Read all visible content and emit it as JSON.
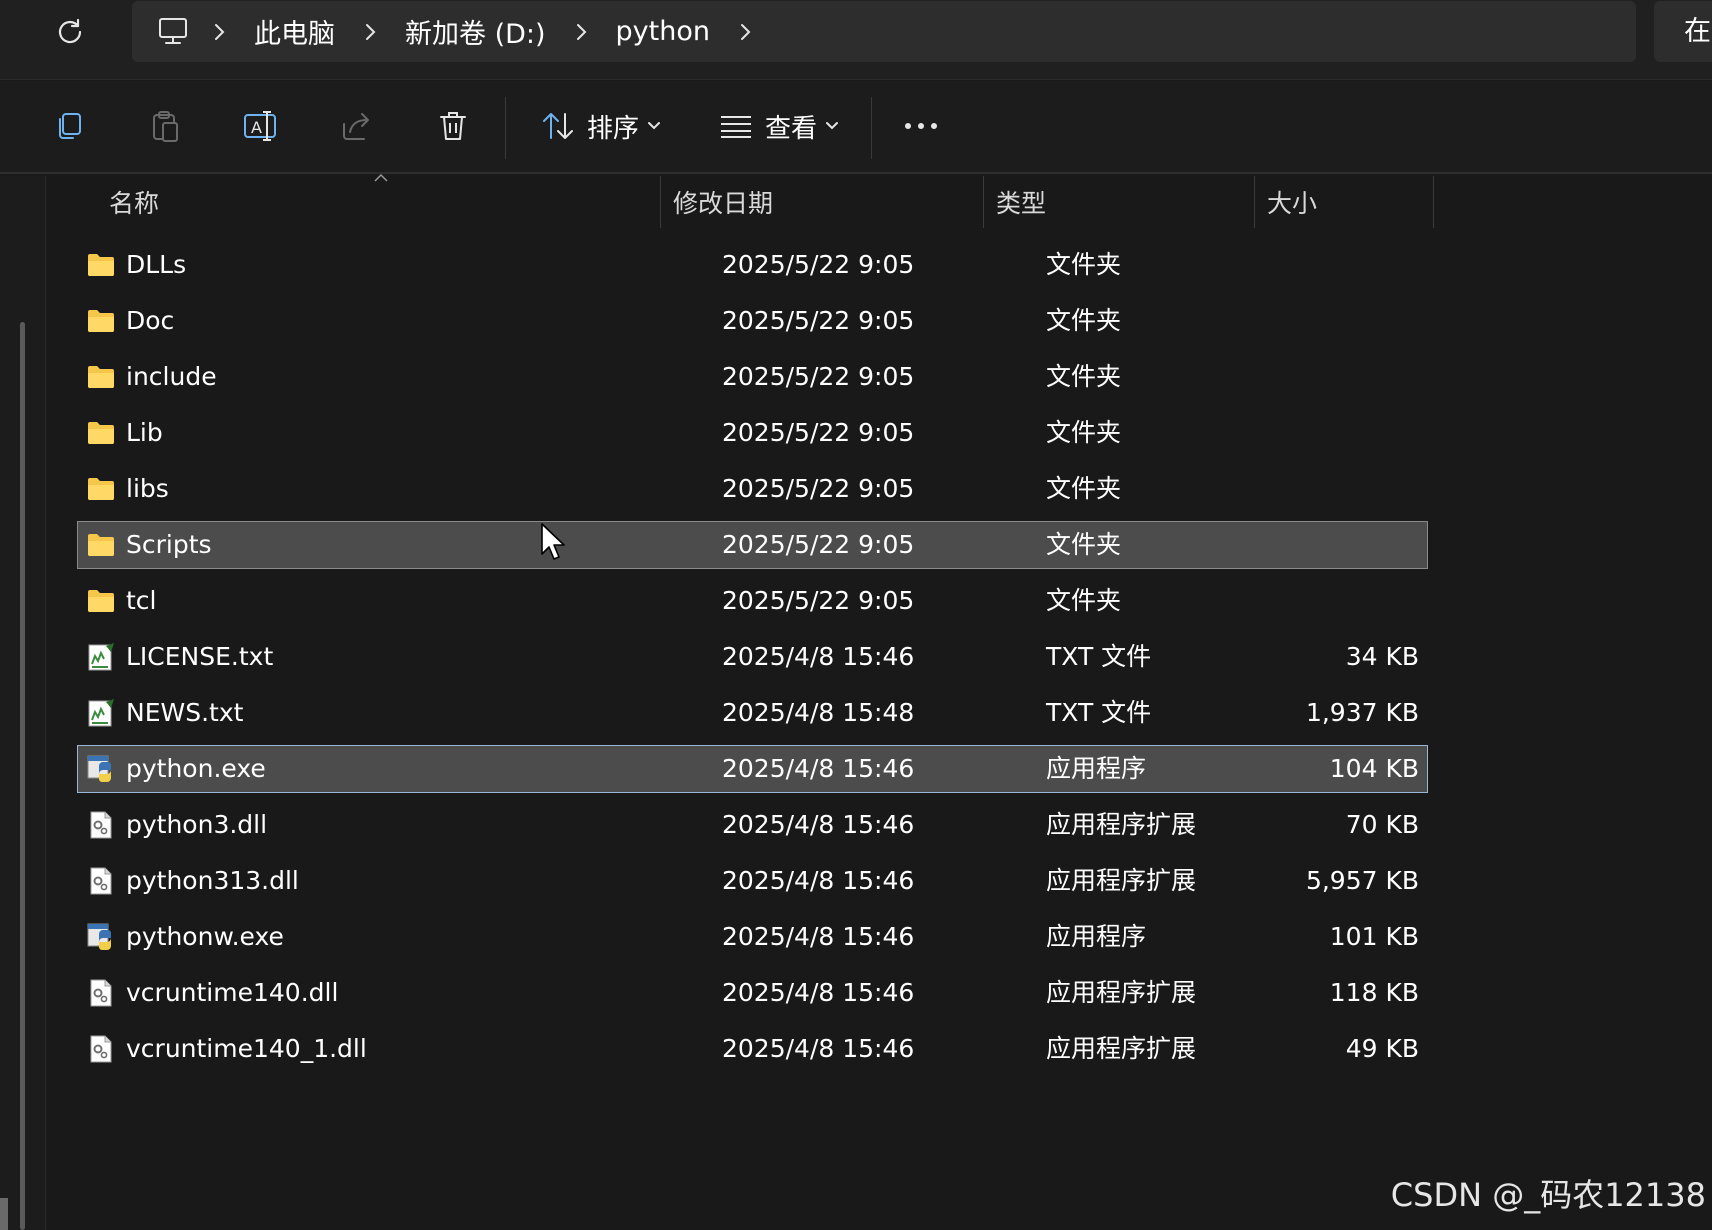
{
  "address_bar": {
    "crumbs": [
      "此电脑",
      "新加卷 (D:)",
      "python"
    ],
    "search_partial": "在"
  },
  "command_bar": {
    "sort_label": "排序",
    "view_label": "查看"
  },
  "columns": {
    "name": "名称",
    "date": "修改日期",
    "type": "类型",
    "size": "大小"
  },
  "files": [
    {
      "name": "DLLs",
      "date": "2025/5/22 9:05",
      "type": "文件夹",
      "size": "",
      "icon": "folder-icon",
      "state": ""
    },
    {
      "name": "Doc",
      "date": "2025/5/22 9:05",
      "type": "文件夹",
      "size": "",
      "icon": "folder-icon",
      "state": ""
    },
    {
      "name": "include",
      "date": "2025/5/22 9:05",
      "type": "文件夹",
      "size": "",
      "icon": "folder-icon",
      "state": ""
    },
    {
      "name": "Lib",
      "date": "2025/5/22 9:05",
      "type": "文件夹",
      "size": "",
      "icon": "folder-icon",
      "state": ""
    },
    {
      "name": "libs",
      "date": "2025/5/22 9:05",
      "type": "文件夹",
      "size": "",
      "icon": "folder-icon",
      "state": ""
    },
    {
      "name": "Scripts",
      "date": "2025/5/22 9:05",
      "type": "文件夹",
      "size": "",
      "icon": "folder-icon",
      "state": "hover"
    },
    {
      "name": "tcl",
      "date": "2025/5/22 9:05",
      "type": "文件夹",
      "size": "",
      "icon": "folder-icon",
      "state": ""
    },
    {
      "name": "LICENSE.txt",
      "date": "2025/4/8 15:46",
      "type": "TXT 文件",
      "size": "34 KB",
      "icon": "text-file-icon",
      "state": ""
    },
    {
      "name": "NEWS.txt",
      "date": "2025/4/8 15:48",
      "type": "TXT 文件",
      "size": "1,937 KB",
      "icon": "text-file-icon",
      "state": ""
    },
    {
      "name": "python.exe",
      "date": "2025/4/8 15:46",
      "type": "应用程序",
      "size": "104 KB",
      "icon": "python-exe-icon",
      "state": "selected"
    },
    {
      "name": "python3.dll",
      "date": "2025/4/8 15:46",
      "type": "应用程序扩展",
      "size": "70 KB",
      "icon": "dll-file-icon",
      "state": ""
    },
    {
      "name": "python313.dll",
      "date": "2025/4/8 15:46",
      "type": "应用程序扩展",
      "size": "5,957 KB",
      "icon": "dll-file-icon",
      "state": ""
    },
    {
      "name": "pythonw.exe",
      "date": "2025/4/8 15:46",
      "type": "应用程序",
      "size": "101 KB",
      "icon": "python-exe-icon",
      "state": ""
    },
    {
      "name": "vcruntime140.dll",
      "date": "2025/4/8 15:46",
      "type": "应用程序扩展",
      "size": "118 KB",
      "icon": "dll-file-icon",
      "state": ""
    },
    {
      "name": "vcruntime140_1.dll",
      "date": "2025/4/8 15:46",
      "type": "应用程序扩展",
      "size": "49 KB",
      "icon": "dll-file-icon",
      "state": ""
    }
  ],
  "watermark": "CSDN @_码农12138",
  "colors": {
    "background": "#191919",
    "folder": "#f4c64b",
    "selection": "#4c4c4c",
    "selection_border": "#99b8d6",
    "python_blue": "#3a74b5",
    "python_yellow": "#f2cf48"
  }
}
